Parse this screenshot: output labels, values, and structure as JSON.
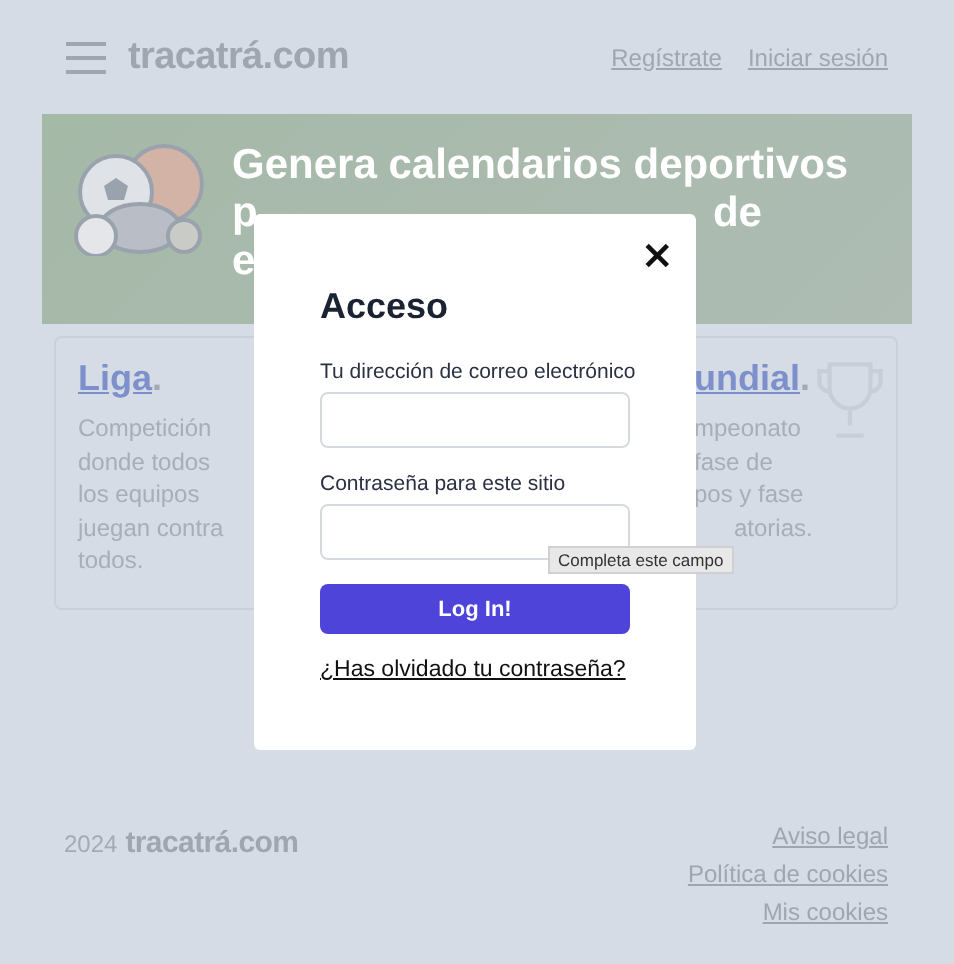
{
  "header": {
    "logo": "tracatrá.com",
    "links": [
      "Regístrate",
      "Iniciar sesión"
    ]
  },
  "banner": {
    "title_line_1": "Genera calendarios deportivos",
    "title_line_2_start": "p",
    "title_line_2_end": "de",
    "title_line_3_start": "e"
  },
  "cards": [
    {
      "title": "Liga",
      "title_end": ".",
      "lines": [
        "Competición",
        "donde todos",
        "los equipos",
        "juegan contra",
        "todos."
      ]
    },
    {
      "title": "undial",
      "title_end": ".",
      "lines": [
        "mpeonato",
        "fase de",
        "pos y fase",
        "atorias."
      ]
    }
  ],
  "modal": {
    "title": "Acceso",
    "close": "×",
    "fields": [
      {
        "label": "Tu dirección de correo electrónico"
      },
      {
        "label": "Contraseña para este sitio"
      }
    ],
    "button": "Log In!",
    "link": "¿Has olvidado tu contraseña?"
  },
  "tooltip": "Completa este campo",
  "footer": {
    "year": "2024",
    "logo": "tracatrá.com",
    "links": [
      "Aviso legal",
      "Política de cookies",
      "Mis cookies"
    ]
  }
}
